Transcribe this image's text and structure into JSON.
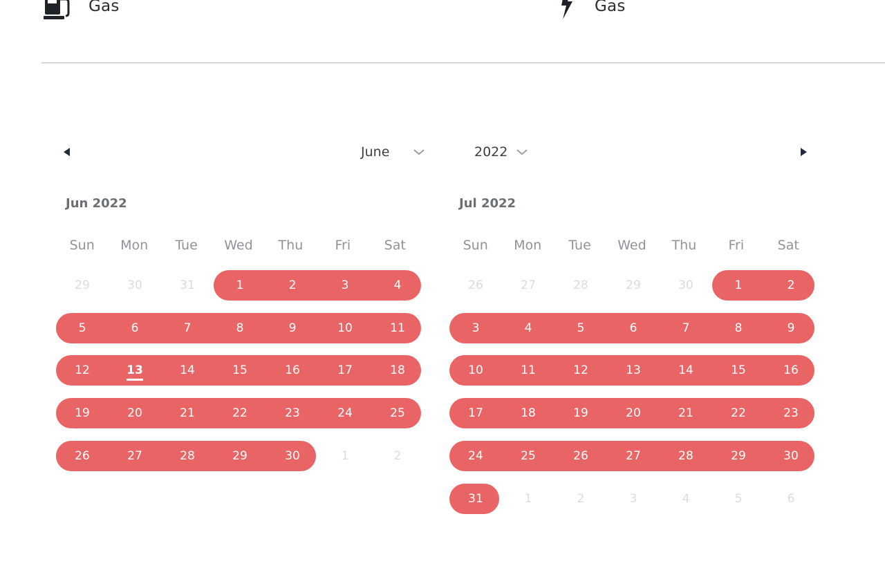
{
  "utility_left": {
    "label": "Gas",
    "icon": "gas-pump-icon"
  },
  "utility_right": {
    "label": "Gas",
    "icon": "lightning-bolt-icon"
  },
  "navigation": {
    "prev_icon": "caret-left-icon",
    "next_icon": "caret-right-icon",
    "month_select": {
      "value": "June",
      "icon": "chevron-down-icon"
    },
    "year_select": {
      "value": "2022",
      "icon": "chevron-down-icon"
    }
  },
  "weekdays": [
    "Sun",
    "Mon",
    "Tue",
    "Wed",
    "Thu",
    "Fri",
    "Sat"
  ],
  "months": [
    {
      "caption": "Jun 2022",
      "today": 13,
      "weeks": [
        [
          [
            "29",
            false
          ],
          [
            "30",
            false
          ],
          [
            "31",
            false
          ],
          [
            "1",
            true
          ],
          [
            "2",
            true
          ],
          [
            "3",
            true
          ],
          [
            "4",
            true
          ]
        ],
        [
          [
            "5",
            true
          ],
          [
            "6",
            true
          ],
          [
            "7",
            true
          ],
          [
            "8",
            true
          ],
          [
            "9",
            true
          ],
          [
            "10",
            true
          ],
          [
            "11",
            true
          ]
        ],
        [
          [
            "12",
            true
          ],
          [
            "13",
            true
          ],
          [
            "14",
            true
          ],
          [
            "15",
            true
          ],
          [
            "16",
            true
          ],
          [
            "17",
            true
          ],
          [
            "18",
            true
          ]
        ],
        [
          [
            "19",
            true
          ],
          [
            "20",
            true
          ],
          [
            "21",
            true
          ],
          [
            "22",
            true
          ],
          [
            "23",
            true
          ],
          [
            "24",
            true
          ],
          [
            "25",
            true
          ]
        ],
        [
          [
            "26",
            true
          ],
          [
            "27",
            true
          ],
          [
            "28",
            true
          ],
          [
            "29",
            true
          ],
          [
            "30",
            true
          ],
          [
            "1",
            false
          ],
          [
            "2",
            false
          ]
        ]
      ]
    },
    {
      "caption": "Jul 2022",
      "today": null,
      "weeks": [
        [
          [
            "26",
            false
          ],
          [
            "27",
            false
          ],
          [
            "28",
            false
          ],
          [
            "29",
            false
          ],
          [
            "30",
            false
          ],
          [
            "1",
            true
          ],
          [
            "2",
            true
          ]
        ],
        [
          [
            "3",
            true
          ],
          [
            "4",
            true
          ],
          [
            "5",
            true
          ],
          [
            "6",
            true
          ],
          [
            "7",
            true
          ],
          [
            "8",
            true
          ],
          [
            "9",
            true
          ]
        ],
        [
          [
            "10",
            true
          ],
          [
            "11",
            true
          ],
          [
            "12",
            true
          ],
          [
            "13",
            true
          ],
          [
            "14",
            true
          ],
          [
            "15",
            true
          ],
          [
            "16",
            true
          ]
        ],
        [
          [
            "17",
            true
          ],
          [
            "18",
            true
          ],
          [
            "19",
            true
          ],
          [
            "20",
            true
          ],
          [
            "21",
            true
          ],
          [
            "22",
            true
          ],
          [
            "23",
            true
          ]
        ],
        [
          [
            "24",
            true
          ],
          [
            "25",
            true
          ],
          [
            "26",
            true
          ],
          [
            "27",
            true
          ],
          [
            "28",
            true
          ],
          [
            "29",
            true
          ],
          [
            "30",
            true
          ]
        ],
        [
          [
            "31",
            true
          ],
          [
            "1",
            false
          ],
          [
            "2",
            false
          ],
          [
            "3",
            false
          ],
          [
            "4",
            false
          ],
          [
            "5",
            false
          ],
          [
            "6",
            false
          ]
        ]
      ]
    }
  ],
  "colors": {
    "range": "#e96565",
    "selected_text": "#ffffff",
    "outside_text": "#d9dbdd"
  }
}
